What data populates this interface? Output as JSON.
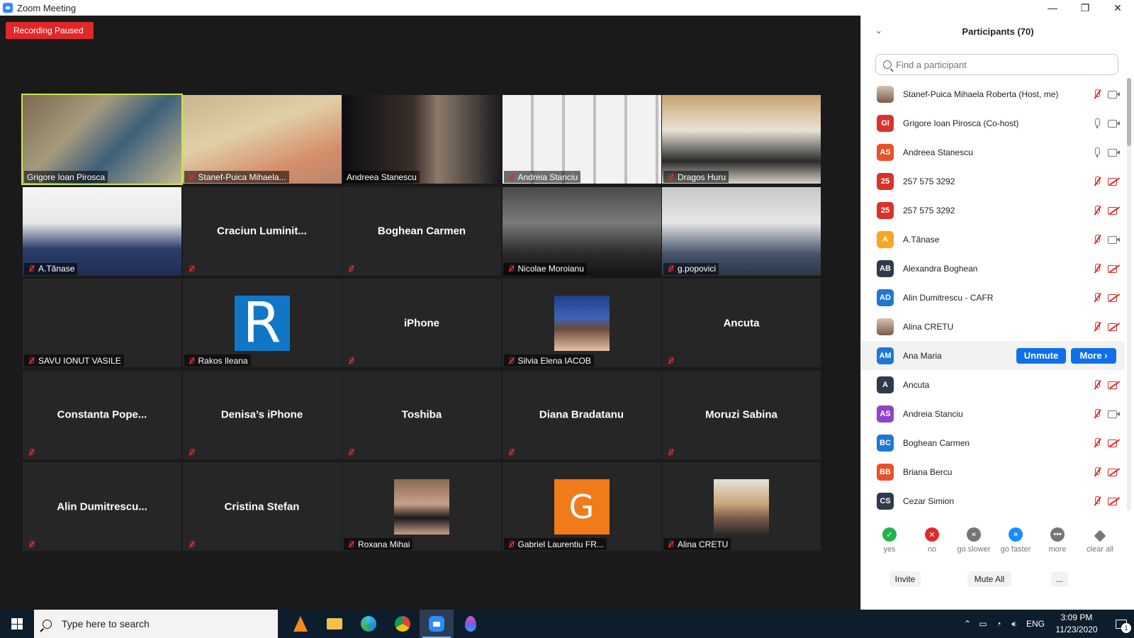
{
  "window": {
    "title": "Zoom Meeting",
    "controls": [
      "minimize-icon",
      "restore-icon",
      "close-icon"
    ]
  },
  "recording": {
    "status": "Recording Paused",
    "color": "#e02828"
  },
  "gallery": {
    "active_border_color": "#c8e64b",
    "tiles": [
      {
        "name": "Grigore Ioan Pirosca",
        "video": true,
        "muted": false,
        "active": true
      },
      {
        "name": "Stanef-Puica Mihaela...",
        "video": true,
        "muted": true
      },
      {
        "name": "Andreea Stanescu",
        "video": true,
        "muted": false
      },
      {
        "name": "Andreia Stanciu",
        "video": true,
        "muted": true
      },
      {
        "name": "Dragos Huru",
        "video": true,
        "muted": true
      },
      {
        "name": "A.Tănase",
        "video": true,
        "muted": true
      },
      {
        "center_name": "Craciun  Luminit...",
        "video": false,
        "muted": true
      },
      {
        "center_name": "Boghean Carmen",
        "video": false,
        "muted": true
      },
      {
        "name": "Nicolae Moroianu",
        "video": true,
        "muted": true
      },
      {
        "name": "g.popovici",
        "video": true,
        "muted": true
      },
      {
        "name": "SAVU IONUT VASILE",
        "video": false,
        "muted": true
      },
      {
        "name": "Rakos Ileana",
        "avatar_letter": "R",
        "muted": true
      },
      {
        "center_name": "iPhone",
        "video": false,
        "muted": true
      },
      {
        "name": "Silvia Elena IACOB",
        "avatar_photo": true,
        "muted": true
      },
      {
        "center_name": "Ancuta",
        "video": false,
        "muted": true
      },
      {
        "center_name": "Constanta  Pope...",
        "video": false,
        "muted": true
      },
      {
        "center_name": "Denisa’s iPhone",
        "video": false,
        "muted": true
      },
      {
        "center_name": "Toshiba",
        "video": false,
        "muted": true
      },
      {
        "center_name": "Diana Bradatanu",
        "video": false,
        "muted": true
      },
      {
        "center_name": "Moruzi Sabina",
        "video": false,
        "muted": true
      },
      {
        "center_name": "Alin  Dumitrescu...",
        "video": false,
        "muted": true
      },
      {
        "center_name": "Cristina Stefan",
        "video": false,
        "muted": true
      },
      {
        "name": "Roxana Mihai",
        "avatar_photo": true,
        "muted": true
      },
      {
        "name": "Gabriel Laurentiu FR...",
        "avatar_letter": "G",
        "muted": true
      },
      {
        "name": "Alina CRETU",
        "avatar_photo": true,
        "muted": true
      }
    ]
  },
  "panel": {
    "title": "Participants (70)",
    "search_placeholder": "Find a participant",
    "participants": [
      {
        "name": "Stanef-Puica Mihaela Roberta (Host, me)",
        "initials": "",
        "photo": true,
        "color": "#e8e8e8",
        "mic": "off",
        "cam": "on"
      },
      {
        "name": "Grigore Ioan Pirosca (Co-host)",
        "initials": "GI",
        "color": "#d9322a",
        "mic": "on",
        "cam": "on"
      },
      {
        "name": "Andreea Stanescu",
        "initials": "AS",
        "color": "#e8512a",
        "mic": "on",
        "cam": "on"
      },
      {
        "name": "257 575 3292",
        "initials": "25",
        "color": "#d9322a",
        "mic": "off",
        "cam": "off"
      },
      {
        "name": "257 575 3292",
        "initials": "25",
        "color": "#d9322a",
        "mic": "off",
        "cam": "off"
      },
      {
        "name": "A.Tănase",
        "initials": "A",
        "color": "#f5a623",
        "mic": "off",
        "cam": "on"
      },
      {
        "name": "Alexandra Boghean",
        "initials": "AB",
        "color": "#2f3b4a",
        "mic": "off",
        "cam": "off"
      },
      {
        "name": "Alin Dumitrescu - CAFR",
        "initials": "AD",
        "color": "#1e78d2",
        "mic": "off",
        "cam": "off"
      },
      {
        "name": "Alina CRETU",
        "initials": "",
        "photo": true,
        "color": "#c9a08a",
        "mic": "off",
        "cam": "off"
      },
      {
        "name": "Ana Maria",
        "initials": "AM",
        "color": "#1e78d2",
        "mic": "none",
        "cam": "none",
        "highlight": true,
        "unmute_label": "Unmute",
        "more_label": "More ›"
      },
      {
        "name": "Ancuta",
        "initials": "A",
        "color": "#2f3b4a",
        "mic": "off",
        "cam": "off"
      },
      {
        "name": "Andreia Stanciu",
        "initials": "AS",
        "color": "#8e44c9",
        "mic": "off",
        "cam": "on"
      },
      {
        "name": "Boghean Carmen",
        "initials": "BC",
        "color": "#1e78d2",
        "mic": "off",
        "cam": "off"
      },
      {
        "name": "Briana Bercu",
        "initials": "BB",
        "color": "#e8512a",
        "mic": "off",
        "cam": "off"
      },
      {
        "name": "Cezar Simion",
        "initials": "CS",
        "color": "#2f3b4a",
        "mic": "off",
        "cam": "off"
      }
    ],
    "reactions": [
      {
        "label": "yes",
        "glyph": "✓",
        "cls": "r-yes"
      },
      {
        "label": "no",
        "glyph": "✕",
        "cls": "r-no"
      },
      {
        "label": "go slower",
        "glyph": "«",
        "cls": "r-slow"
      },
      {
        "label": "go faster",
        "glyph": "»",
        "cls": "r-fast"
      },
      {
        "label": "more",
        "glyph": "•••",
        "cls": "r-more"
      },
      {
        "label": "clear all",
        "glyph": "",
        "cls": "r-clear"
      }
    ],
    "buttons": {
      "invite": "Invite",
      "mute_all": "Mute All",
      "more": "..."
    }
  },
  "taskbar": {
    "search_placeholder": "Type here to search",
    "apps": [
      "vlc-icon",
      "file-explorer-icon",
      "edge-icon",
      "chrome-icon",
      "zoom-icon",
      "drop-app-icon"
    ],
    "active_app": "zoom-icon",
    "language": "ENG",
    "time": "3:09 PM",
    "date": "11/23/2020",
    "notification_count": "1"
  }
}
